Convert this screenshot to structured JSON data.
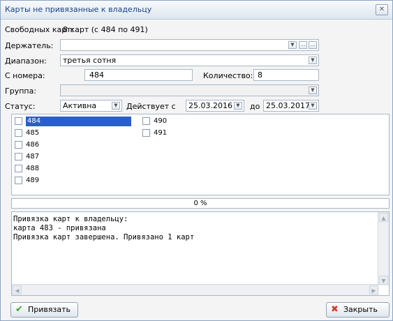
{
  "window": {
    "title": "Карты не привязанные к владельцу"
  },
  "summary": {
    "label": "Свободных карт:",
    "value": "8 карт (с 484 по 491)"
  },
  "form": {
    "holder_label": "Держатель:",
    "holder_value": "",
    "range_label": "Диапазон:",
    "range_value": "третья сотня",
    "from_label": "С номера:",
    "from_value": "484",
    "count_label": "Количество:",
    "count_value": "8",
    "group_label": "Группа:",
    "group_value": "",
    "status_label": "Статус:",
    "status_value": "Активна",
    "valid_from_label": "Действует с",
    "valid_from_value": "25.03.2016",
    "valid_to_label": "до",
    "valid_to_value": "25.03.2017"
  },
  "cards": [
    {
      "number": "484",
      "checked": false,
      "selected": true
    },
    {
      "number": "485",
      "checked": false,
      "selected": false
    },
    {
      "number": "486",
      "checked": false,
      "selected": false
    },
    {
      "number": "487",
      "checked": false,
      "selected": false
    },
    {
      "number": "488",
      "checked": false,
      "selected": false
    },
    {
      "number": "489",
      "checked": false,
      "selected": false
    },
    {
      "number": "490",
      "checked": false,
      "selected": false
    },
    {
      "number": "491",
      "checked": false,
      "selected": false
    }
  ],
  "progress": {
    "text": "0 %",
    "value": 0
  },
  "log": {
    "lines": [
      "Привязка карт к владельцу:",
      "карта 483 - привязана",
      "Привязка карт завершена. Привязано 1 карт"
    ]
  },
  "buttons": {
    "bind_label": "Привязать",
    "close_label": "Закрыть"
  },
  "icons": {
    "bind": "check-icon",
    "close": "x-icon"
  },
  "colors": {
    "title_text": "#15428b",
    "selection": "#2a5fc8",
    "bind_icon": "#3aa132",
    "close_icon": "#d83a2a"
  }
}
